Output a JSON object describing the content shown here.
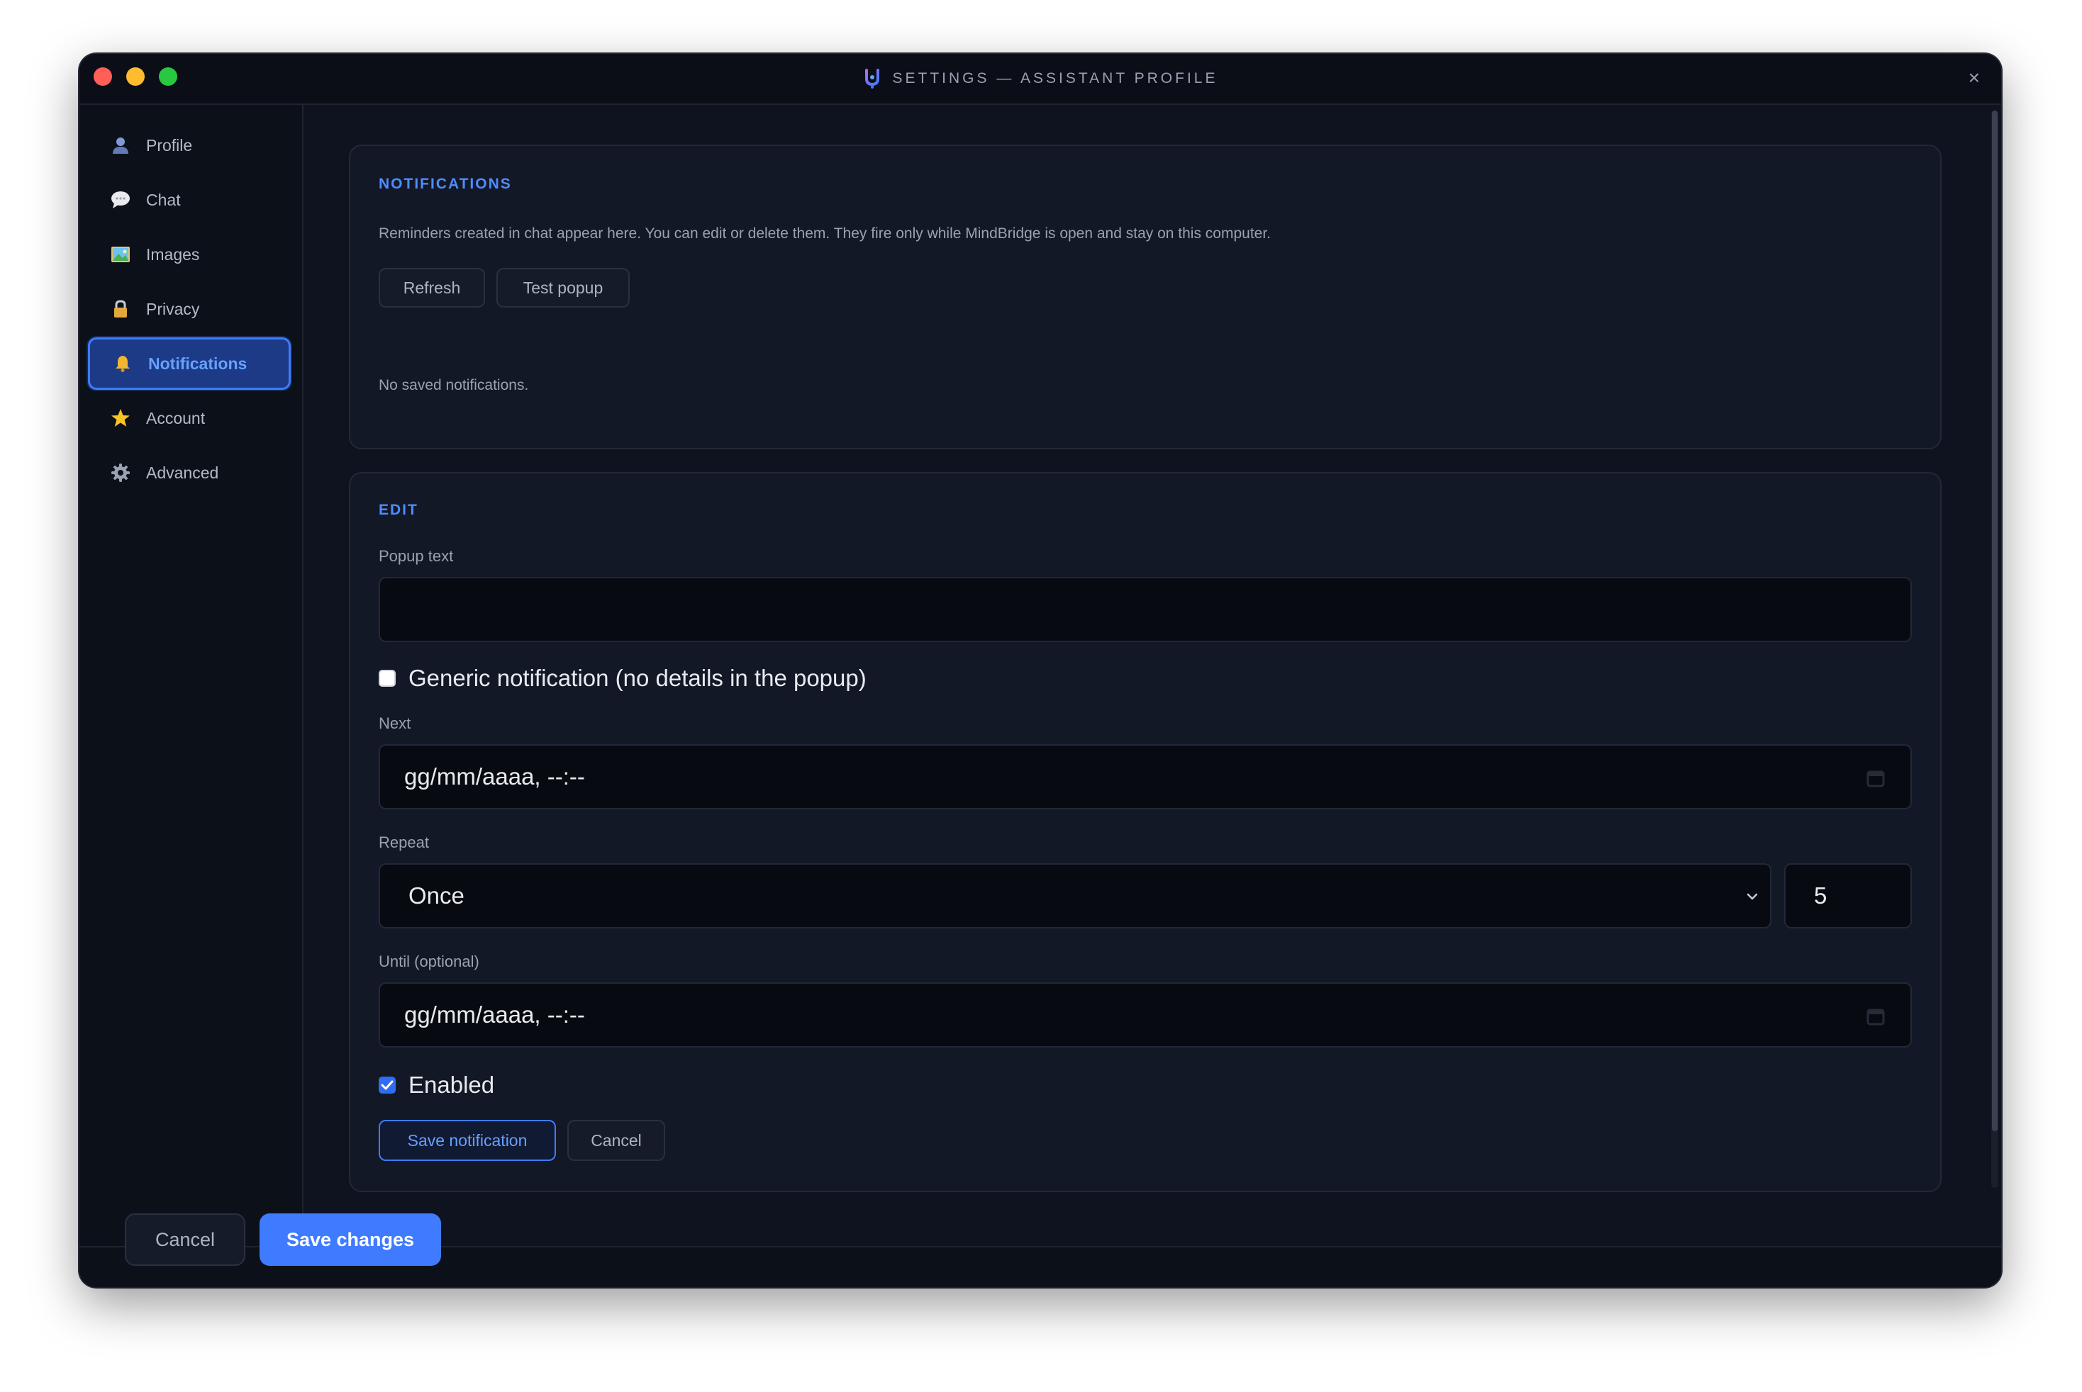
{
  "window": {
    "title": "SETTINGS — ASSISTANT PROFILE",
    "close_symbol": "×"
  },
  "sidebar": {
    "items": [
      {
        "label": "Profile",
        "icon": "person-icon"
      },
      {
        "label": "Chat",
        "icon": "speech-bubble-icon"
      },
      {
        "label": "Images",
        "icon": "picture-icon"
      },
      {
        "label": "Privacy",
        "icon": "lock-icon"
      },
      {
        "label": "Notifications",
        "icon": "bell-icon",
        "active": true
      },
      {
        "label": "Account",
        "icon": "star-icon"
      },
      {
        "label": "Advanced",
        "icon": "gear-icon"
      }
    ]
  },
  "notifications": {
    "title": "NOTIFICATIONS",
    "description": "Reminders created in chat appear here. You can edit or delete them. They fire only while MindBridge is open and stay on this computer.",
    "refresh_label": "Refresh",
    "test_popup_label": "Test popup",
    "empty_text": "No saved notifications."
  },
  "edit": {
    "title": "EDIT",
    "popup_text_label": "Popup text",
    "popup_text_value": "",
    "generic_label": "Generic notification (no details in the popup)",
    "generic_checked": false,
    "next_label": "Next",
    "next_value": "gg/mm/aaaa, --:--",
    "repeat_label": "Repeat",
    "repeat_value": "Once",
    "repeat_count": "5",
    "until_label": "Until (optional)",
    "until_value": "gg/mm/aaaa, --:--",
    "enabled_label": "Enabled",
    "enabled_checked": true,
    "save_label": "Save notification",
    "cancel_label": "Cancel"
  },
  "footer": {
    "cancel_label": "Cancel",
    "save_label": "Save changes"
  },
  "colors": {
    "accent": "#3f7bff",
    "background": "#0f1320",
    "card": "#131827"
  }
}
